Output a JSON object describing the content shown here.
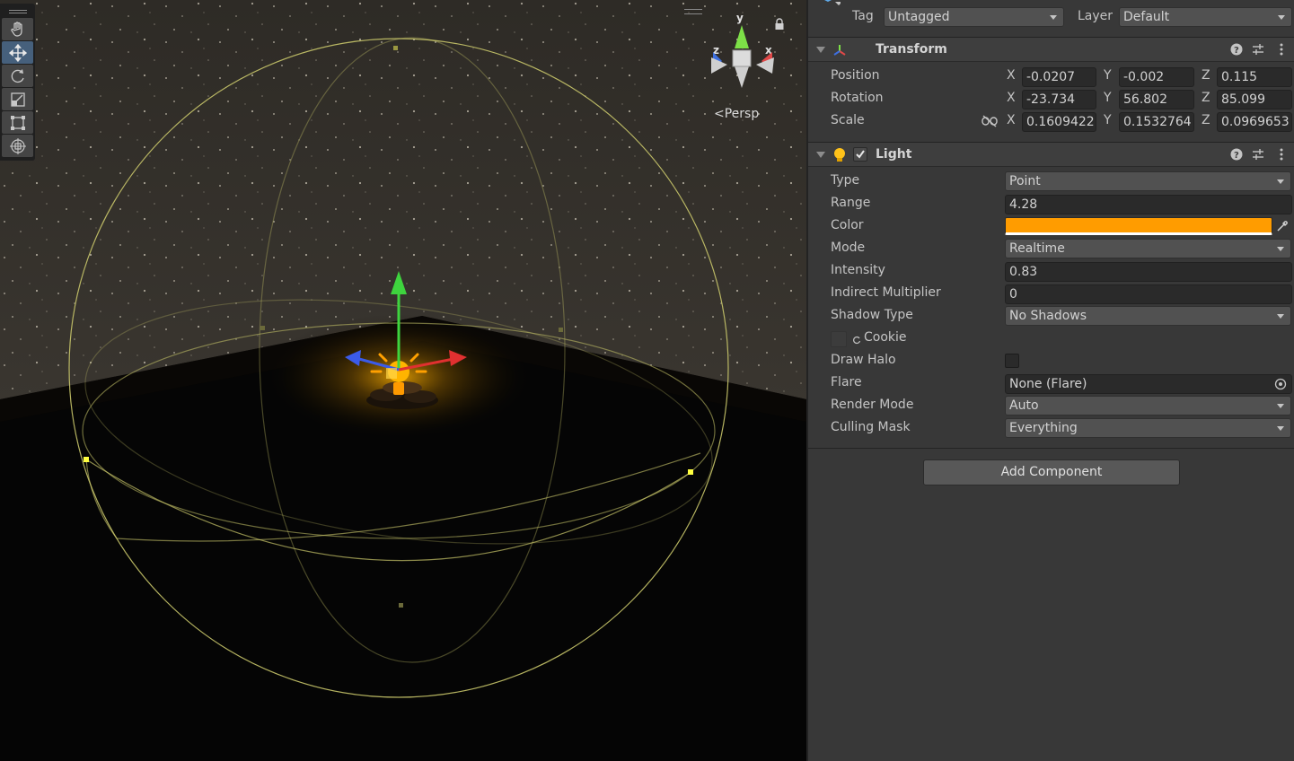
{
  "scene": {
    "view_mode_label": "Persp",
    "gizmo_axes": {
      "y": "y",
      "x": "x",
      "z": "z"
    },
    "tools": [
      {
        "name": "hand-tool",
        "icon": "hand-icon",
        "active": false
      },
      {
        "name": "move-tool",
        "icon": "move-icon",
        "active": true
      },
      {
        "name": "rotate-tool",
        "icon": "rotate-icon",
        "active": false
      },
      {
        "name": "scale-tool",
        "icon": "scale-icon",
        "active": false
      },
      {
        "name": "rect-tool",
        "icon": "rect-icon",
        "active": false
      },
      {
        "name": "transform-tool",
        "icon": "transform-icon",
        "active": false
      }
    ],
    "light_color": "#ffc21a"
  },
  "inspector": {
    "tag_label": "Tag",
    "tag_value": "Untagged",
    "layer_label": "Layer",
    "layer_value": "Default",
    "transform": {
      "title": "Transform",
      "position_label": "Position",
      "rotation_label": "Rotation",
      "scale_label": "Scale",
      "axis_x": "X",
      "axis_y": "Y",
      "axis_z": "Z",
      "position": {
        "x": "-0.0207",
        "y": "-0.002",
        "z": "0.115"
      },
      "rotation": {
        "x": "-23.734",
        "y": "56.802",
        "z": "85.099"
      },
      "scale": {
        "x": "0.1609422",
        "y": "0.1532764",
        "z": "0.0969653"
      }
    },
    "light": {
      "title": "Light",
      "enabled": true,
      "type_label": "Type",
      "type_value": "Point",
      "range_label": "Range",
      "range_value": "4.28",
      "color_label": "Color",
      "color_value": "#ff9c00",
      "mode_label": "Mode",
      "mode_value": "Realtime",
      "intensity_label": "Intensity",
      "intensity_value": "0.83",
      "indirect_label": "Indirect Multiplier",
      "indirect_value": "0",
      "shadow_label": "Shadow Type",
      "shadow_value": "No Shadows",
      "cookie_label": "Cookie",
      "halo_label": "Draw Halo",
      "halo_checked": false,
      "flare_label": "Flare",
      "flare_value": "None (Flare)",
      "render_mode_label": "Render Mode",
      "render_mode_value": "Auto",
      "culling_label": "Culling Mask",
      "culling_value": "Everything"
    },
    "add_component_label": "Add Component"
  }
}
